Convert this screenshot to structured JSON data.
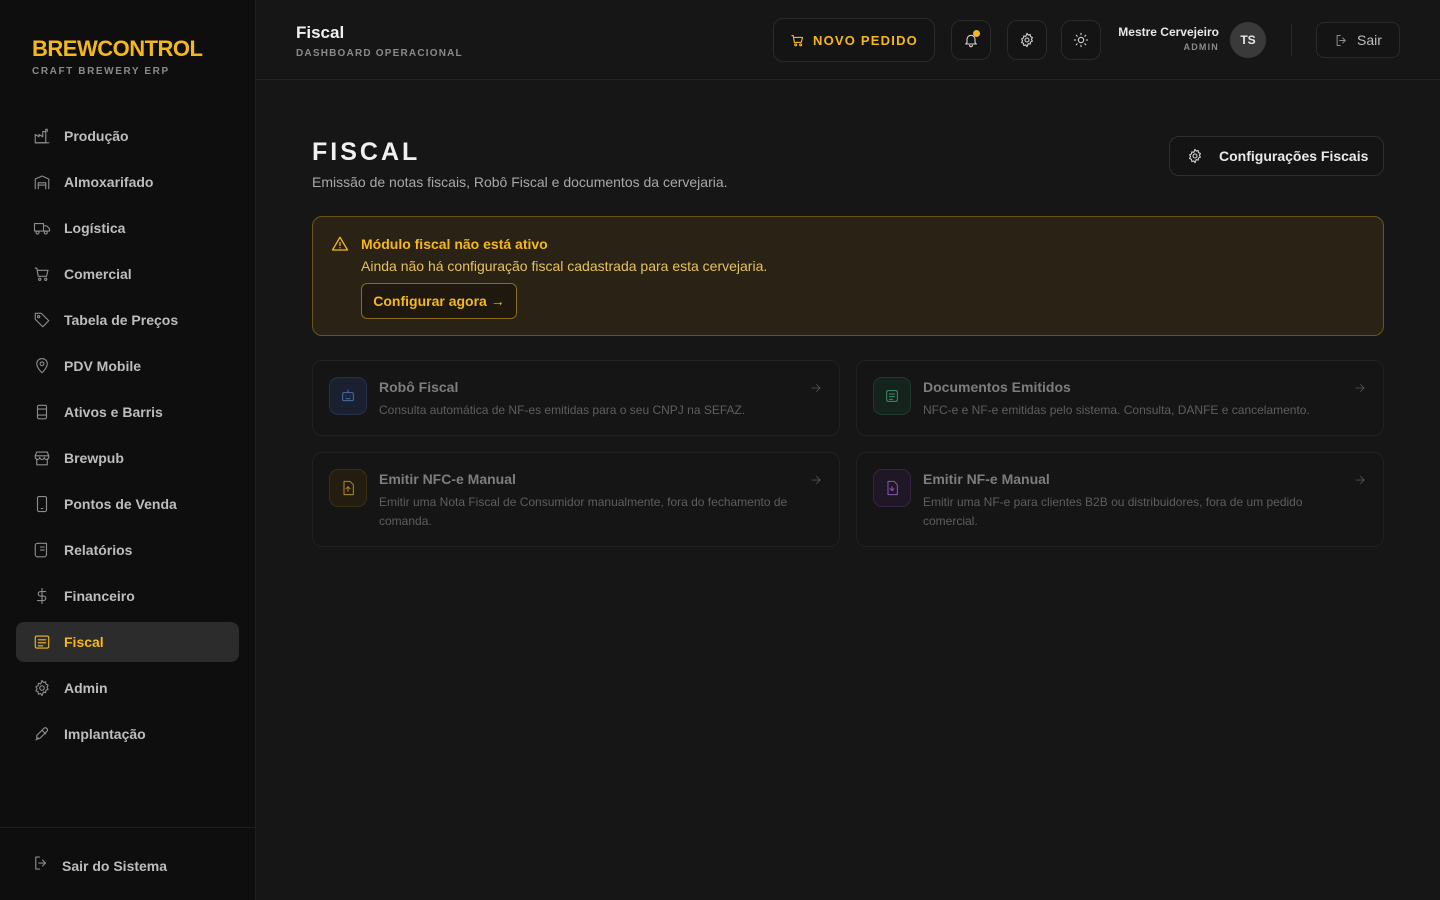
{
  "brand": {
    "name": "BREWCONTROL",
    "subtitle": "CRAFT BREWERY ERP"
  },
  "sidebar": {
    "items": [
      {
        "label": "Produção",
        "icon": "factory-icon"
      },
      {
        "label": "Almoxarifado",
        "icon": "warehouse-icon"
      },
      {
        "label": "Logística",
        "icon": "truck-icon"
      },
      {
        "label": "Comercial",
        "icon": "cart-icon"
      },
      {
        "label": "Tabela de Preços",
        "icon": "tag-icon"
      },
      {
        "label": "PDV Mobile",
        "icon": "map-pin-icon"
      },
      {
        "label": "Ativos e Barris",
        "icon": "barrel-icon"
      },
      {
        "label": "Brewpub",
        "icon": "store-icon"
      },
      {
        "label": "Pontos de Venda",
        "icon": "smartphone-icon"
      },
      {
        "label": "Relatórios",
        "icon": "scroll-icon"
      },
      {
        "label": "Financeiro",
        "icon": "dollar-icon"
      },
      {
        "label": "Fiscal",
        "icon": "receipt-icon",
        "active": true
      },
      {
        "label": "Admin",
        "icon": "gear-icon"
      },
      {
        "label": "Implantação",
        "icon": "rocket-icon"
      }
    ],
    "logout_label": "Sair do Sistema"
  },
  "header": {
    "title": "Fiscal",
    "subtitle": "DASHBOARD OPERACIONAL",
    "new_order_label": "NOVO PEDIDO",
    "user_name": "Mestre Cervejeiro",
    "user_role": "ADMIN",
    "user_initials": "TS",
    "exit_label": "Sair"
  },
  "main": {
    "title": "FISCAL",
    "subtitle": "Emissão de notas fiscais, Robô Fiscal e documentos da cervejaria.",
    "config_button_label": "Configurações Fiscais",
    "alert": {
      "title": "Módulo fiscal não está ativo",
      "text": "Ainda não há configuração fiscal cadastrada para esta cervejaria.",
      "action_label": "Configurar agora →"
    },
    "cards": [
      {
        "title": "Robô Fiscal",
        "description": "Consulta automática de NF-es emitidas para o seu CNPJ na SEFAZ.",
        "icon": "robot-icon",
        "color": "#4a6ea8"
      },
      {
        "title": "Documentos Emitidos",
        "description": "NFC-e e NF-e emitidas pelo sistema. Consulta, DANFE e cancelamento.",
        "icon": "document-list-icon",
        "color": "#3a8f6a"
      },
      {
        "title": "Emitir NFC-e Manual",
        "description": "Emitir uma Nota Fiscal de Consumidor manualmente, fora do fechamento de comanda.",
        "icon": "file-upload-icon",
        "color": "#b08a2a"
      },
      {
        "title": "Emitir NF-e Manual",
        "description": "Emitir uma NF-e para clientes B2B ou distribuidores, fora de um pedido comercial.",
        "icon": "file-download-icon",
        "color": "#8a5ab0"
      }
    ]
  },
  "colors": {
    "accent": "#f5b81c",
    "background": "#161616",
    "sidebar": "#0e0e0e"
  }
}
